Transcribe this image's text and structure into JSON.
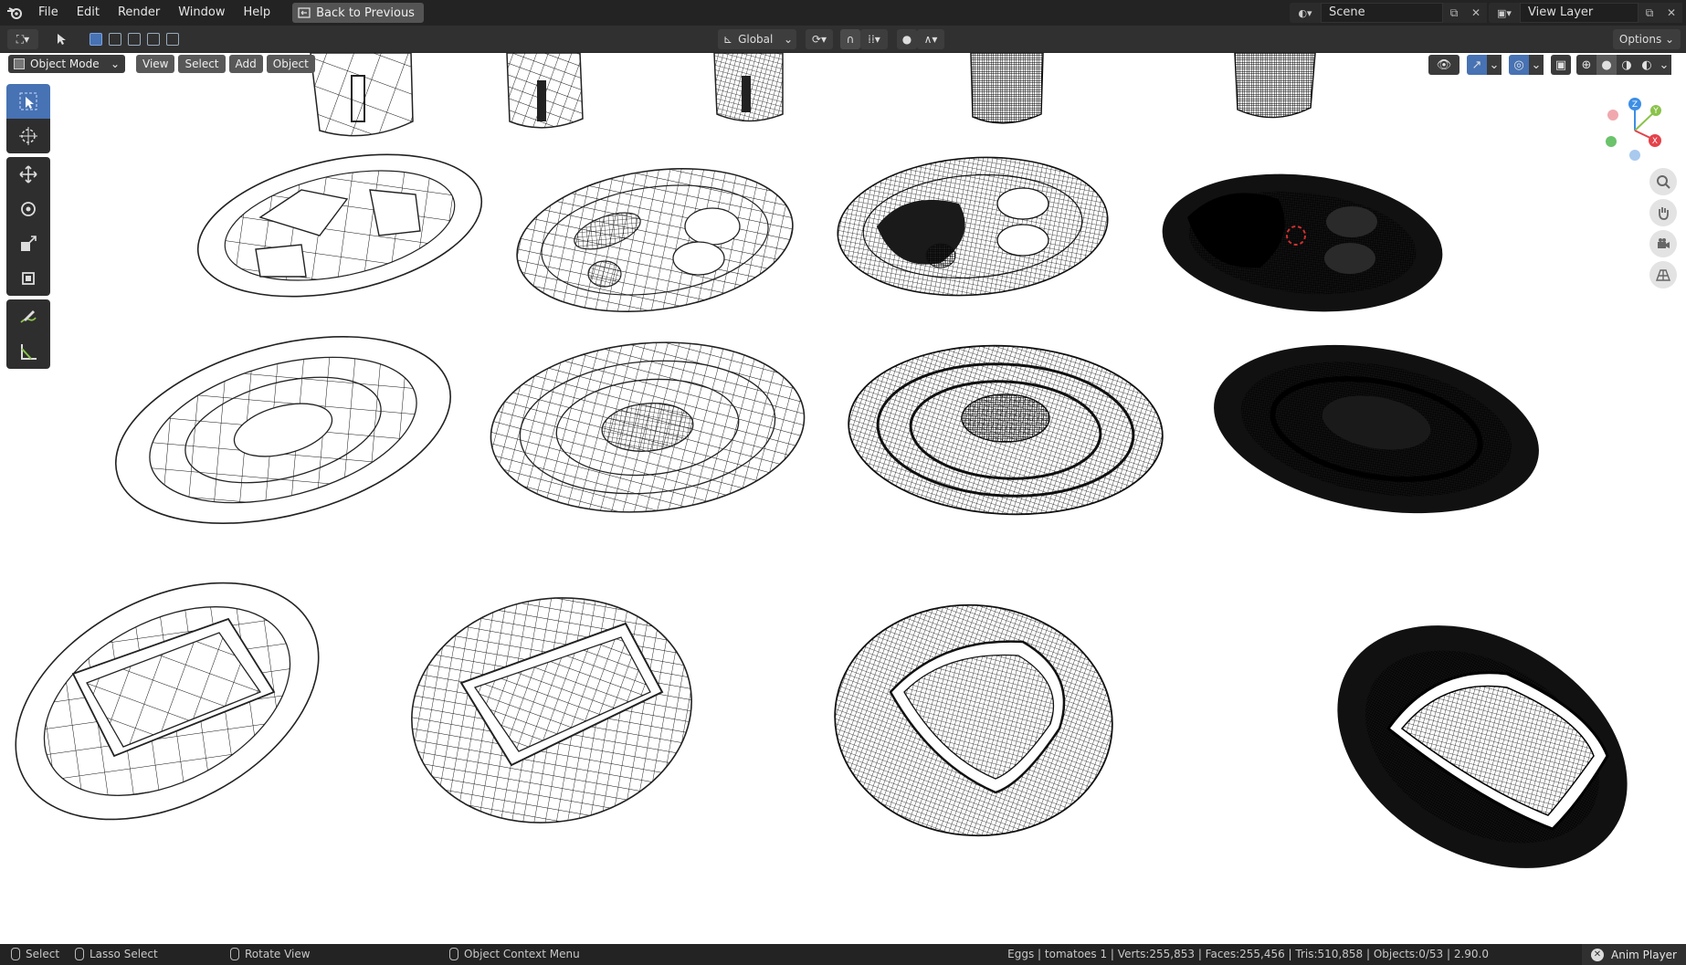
{
  "topbar": {
    "menus": [
      "File",
      "Edit",
      "Render",
      "Window",
      "Help"
    ],
    "back_button": "Back to Previous",
    "scene_name": "Scene",
    "view_layer_name": "View Layer"
  },
  "toolbar": {
    "orientation": "Global",
    "options_label": "Options"
  },
  "viewport": {
    "mode": "Object Mode",
    "menus": [
      "View",
      "Select",
      "Add",
      "Object"
    ],
    "gizmo_axes": [
      "Z",
      "Y",
      "X"
    ]
  },
  "statusbar": {
    "select": "Select",
    "lasso": "Lasso Select",
    "rotate": "Rotate View",
    "context": "Object Context Menu",
    "stats": "Eggs | tomatoes 1 | Verts:255,853 | Faces:255,456 | Tris:510,858 | Objects:0/53 | 2.90.0",
    "anim_player": "Anim Player"
  },
  "colors": {
    "accent": "#4772b3",
    "axis_x": "#e5424a",
    "axis_y": "#8bc34a",
    "axis_z": "#3d8ee6"
  }
}
